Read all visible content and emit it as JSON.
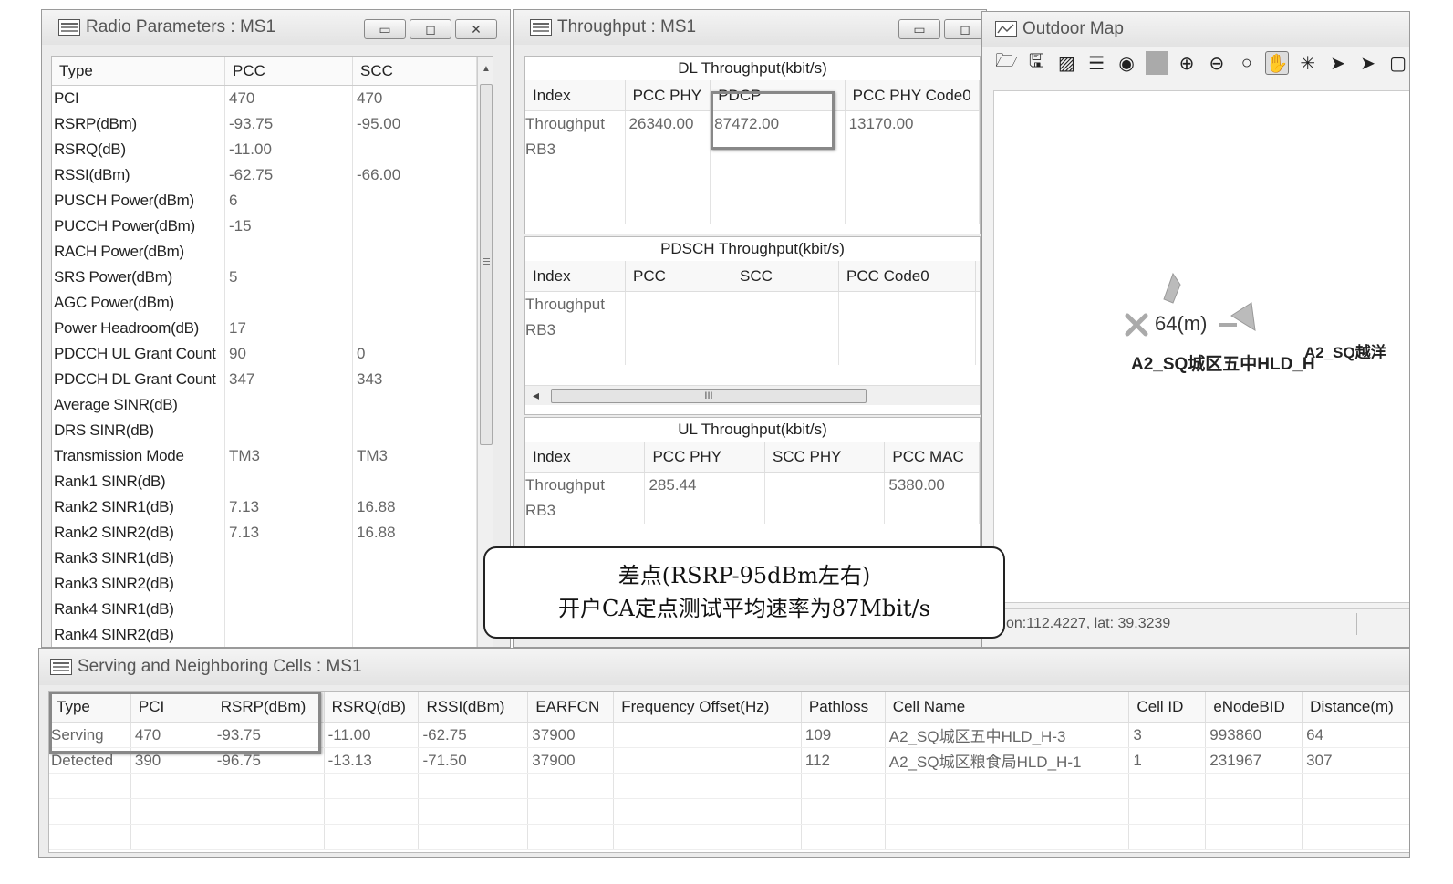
{
  "radio": {
    "title": "Radio Parameters : MS1",
    "btn_min": "▭",
    "btn_max": "◻",
    "btn_close": "✕",
    "columns": [
      "Type",
      "PCC",
      "SCC"
    ],
    "rows": [
      [
        "PCI",
        "470",
        "470"
      ],
      [
        "RSRP(dBm)",
        "-93.75",
        "-95.00"
      ],
      [
        "RSRQ(dB)",
        "-11.00",
        ""
      ],
      [
        "RSSI(dBm)",
        "-62.75",
        "-66.00"
      ],
      [
        "PUSCH Power(dBm)",
        "6",
        ""
      ],
      [
        "PUCCH Power(dBm)",
        "-15",
        ""
      ],
      [
        "RACH Power(dBm)",
        "",
        ""
      ],
      [
        "SRS Power(dBm)",
        "5",
        ""
      ],
      [
        "AGC Power(dBm)",
        "",
        ""
      ],
      [
        "Power Headroom(dB)",
        "17",
        ""
      ],
      [
        "PDCCH UL Grant Count",
        "90",
        "0"
      ],
      [
        "PDCCH DL Grant Count",
        "347",
        "343"
      ],
      [
        "Average SINR(dB)",
        "",
        ""
      ],
      [
        "DRS SINR(dB)",
        "",
        ""
      ],
      [
        "Transmission Mode",
        "TM3",
        "TM3"
      ],
      [
        "Rank1 SINR(dB)",
        "",
        ""
      ],
      [
        "Rank2 SINR1(dB)",
        "7.13",
        "16.88"
      ],
      [
        "Rank2 SINR2(dB)",
        "7.13",
        "16.88"
      ],
      [
        "Rank3 SINR1(dB)",
        "",
        ""
      ],
      [
        "Rank3 SINR2(dB)",
        "",
        ""
      ],
      [
        "Rank4 SINR1(dB)",
        "",
        ""
      ],
      [
        "Rank4 SINR2(dB)",
        "",
        ""
      ]
    ]
  },
  "throughput": {
    "title": "Throughput : MS1",
    "btn_min": "▭",
    "btn_max": "◻",
    "dl": {
      "title": "DL Throughput(kbit/s)",
      "columns": [
        "Index",
        "PCC PHY",
        "PDCP",
        "PCC PHY Code0"
      ],
      "rows": [
        [
          "Throughput",
          "26340.00",
          "87472.00",
          "13170.00"
        ],
        [
          "RB3",
          "",
          "",
          ""
        ]
      ]
    },
    "pdsch": {
      "title": "PDSCH Throughput(kbit/s)",
      "columns": [
        "Index",
        "PCC",
        "SCC",
        "PCC Code0"
      ],
      "rows": [
        [
          "Throughput",
          "",
          "",
          ""
        ],
        [
          "RB3",
          "",
          "",
          ""
        ]
      ],
      "scroll_thumb": "III",
      "scroll_left": "◂"
    },
    "ul": {
      "title": "UL Throughput(kbit/s)",
      "columns": [
        "Index",
        "PCC PHY",
        "SCC PHY",
        "PCC MAC"
      ],
      "rows": [
        [
          "Throughput",
          "285.44",
          "",
          "5380.00"
        ],
        [
          "RB3",
          "",
          "",
          ""
        ]
      ]
    }
  },
  "map": {
    "title": "Outdoor Map",
    "tools": [
      "open-folder",
      "save",
      "image",
      "layers",
      "find",
      "zoom-in",
      "zoom-out",
      "zoom",
      "pan",
      "measure",
      "select",
      "select-plus",
      "window"
    ],
    "distance_label": "64(m)",
    "cell_label_1": "A2_SQ城区五中HLD_H",
    "cell_label_2": "A2_SQ越洋",
    "status": "on:112.4227, lat: 39.3239"
  },
  "callout": {
    "line1": "差点(RSRP-95dBm左右)",
    "line2": "开户CA定点测试平均速率为87Mbit/s"
  },
  "cells": {
    "title": "Serving and Neighboring Cells : MS1",
    "columns": [
      "Type",
      "PCI",
      "RSRP(dBm)",
      "RSRQ(dB)",
      "RSSI(dBm)",
      "EARFCN",
      "Frequency Offset(Hz)",
      "Pathloss",
      "Cell Name",
      "Cell ID",
      "eNodeBID",
      "Distance(m)"
    ],
    "rows": [
      [
        "Serving",
        "470",
        "-93.75",
        "-11.00",
        "-62.75",
        "37900",
        "",
        "109",
        "A2_SQ城区五中HLD_H-3",
        "3",
        "993860",
        "64"
      ],
      [
        "Detected",
        "390",
        "-96.75",
        "-13.13",
        "-71.50",
        "37900",
        "",
        "112",
        "A2_SQ城区粮食局HLD_H-1",
        "1",
        "231967",
        "307"
      ]
    ]
  }
}
